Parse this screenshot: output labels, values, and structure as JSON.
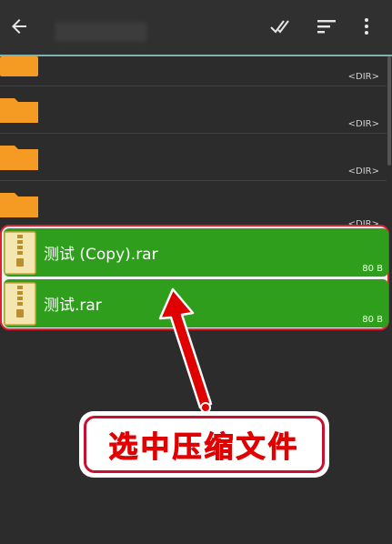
{
  "toolbar": {
    "back_icon": "back-arrow-icon",
    "select_all_icon": "double-check-icon",
    "sort_icon": "sort-icon",
    "more_icon": "more-vert-icon"
  },
  "folders": [
    {
      "type_label": "<DIR>"
    },
    {
      "type_label": "<DIR>"
    },
    {
      "type_label": "<DIR>"
    },
    {
      "type_label": "<DIR>"
    }
  ],
  "files": [
    {
      "name": "测试 (Copy).rar",
      "size": "80 B",
      "selected": true
    },
    {
      "name": "测试.rar",
      "size": "80 B",
      "selected": true
    }
  ],
  "annotation": {
    "label": "选中压缩文件",
    "color": "#e00000"
  },
  "colors": {
    "selection": "#2e9e1c",
    "folder": "#f59a23",
    "accent": "#7fb3b3"
  }
}
